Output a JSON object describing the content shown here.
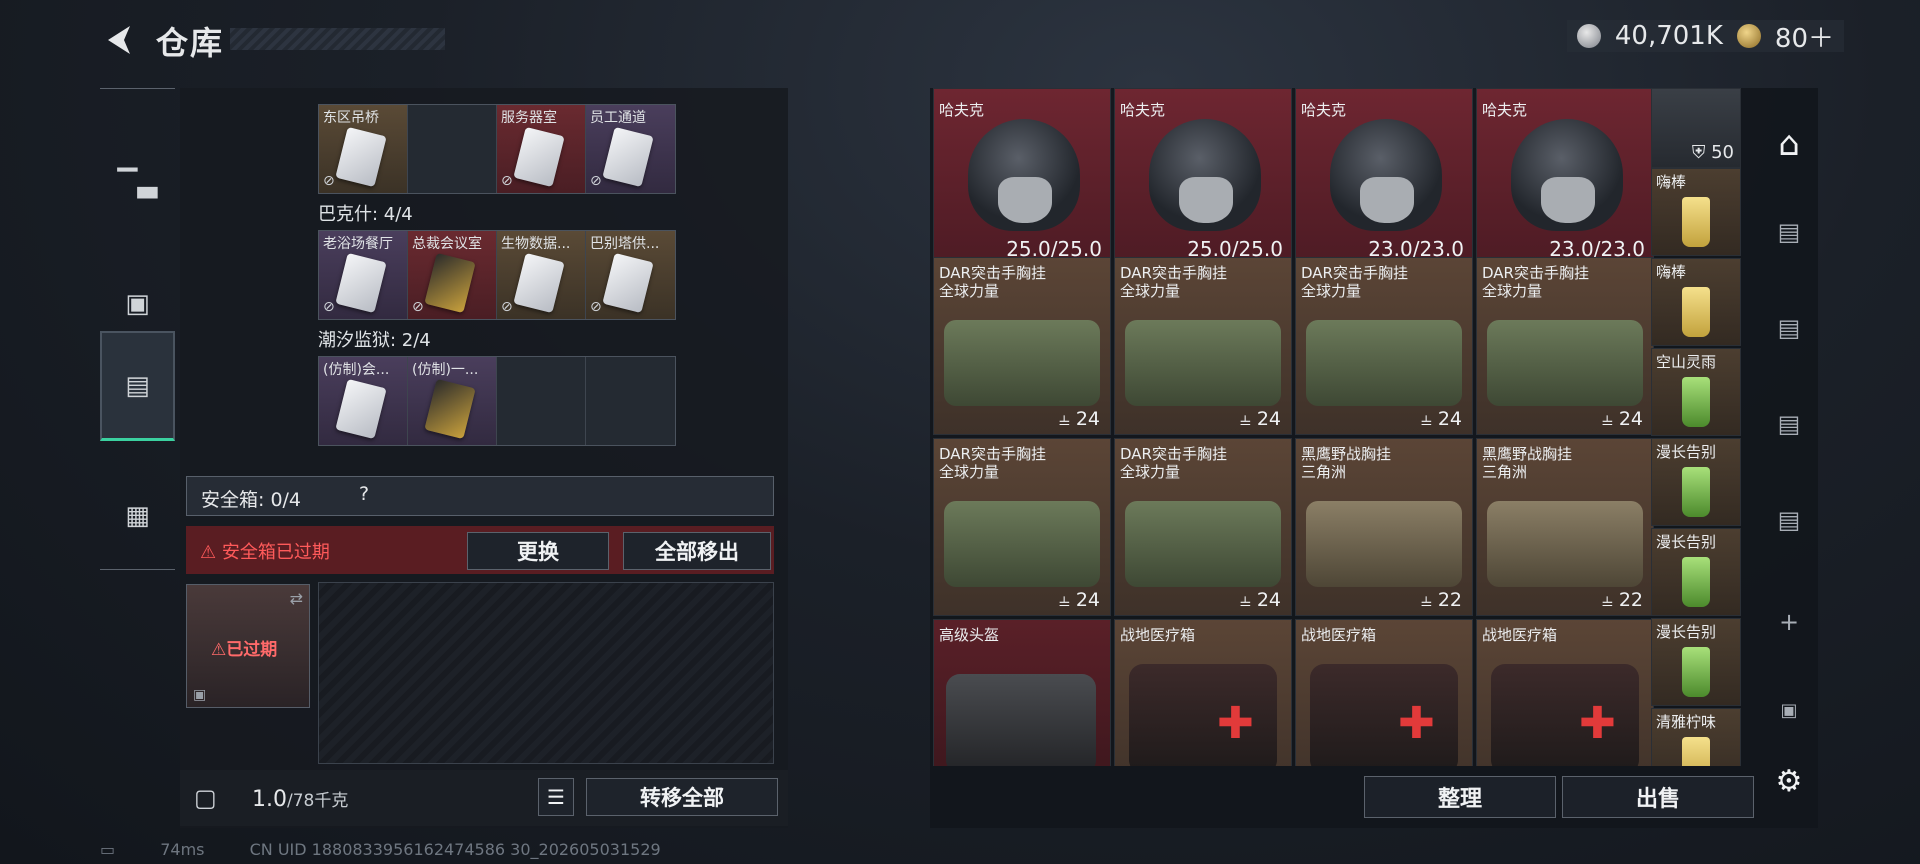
{
  "header": {
    "title": "仓库",
    "silver_amount": "40,701K",
    "gold_amount": "80＋"
  },
  "leftnav": {
    "items": [
      "weapon-icon",
      "key-icon",
      "backpack-icon",
      "toolbox-icon"
    ]
  },
  "keys": {
    "row1_labels": [
      "东区吊桥",
      "",
      "服务器室",
      "员工通道"
    ],
    "group2_label": "巴克什: 4/4",
    "row2_labels": [
      "老浴场餐厅",
      "总裁会议室",
      "生物数据...",
      "巴别塔供..."
    ],
    "group3_label": "潮汐监狱: 2/4",
    "row3_labels": [
      "(仿制)会...",
      "(仿制)一...",
      "",
      ""
    ]
  },
  "safebox": {
    "label": "安全箱: 0/4",
    "help": "?",
    "expired_text": "安全箱已过期",
    "replace_btn": "更换",
    "move_all_btn": "全部移出",
    "slot_text": "已过期"
  },
  "weight": {
    "value": "1.0",
    "unit": "/78千克",
    "transfer_all": "转移全部"
  },
  "stash": {
    "row1": [
      {
        "n1": "",
        "n2": "哈夫克",
        "cnt": "25.0/25.0"
      },
      {
        "n1": "",
        "n2": "哈夫克",
        "cnt": "25.0/25.0"
      },
      {
        "n1": "",
        "n2": "哈夫克",
        "cnt": "23.0/23.0"
      },
      {
        "n1": "",
        "n2": "哈夫克",
        "cnt": "23.0/23.0"
      }
    ],
    "row2": [
      {
        "n1": "DAR突击手胸挂",
        "n2": "全球力量",
        "cnt": "24"
      },
      {
        "n1": "DAR突击手胸挂",
        "n2": "全球力量",
        "cnt": "24"
      },
      {
        "n1": "DAR突击手胸挂",
        "n2": "全球力量",
        "cnt": "24"
      },
      {
        "n1": "DAR突击手胸挂",
        "n2": "全球力量",
        "cnt": "24"
      }
    ],
    "row3": [
      {
        "n1": "DAR突击手胸挂",
        "n2": "全球力量",
        "cnt": "24"
      },
      {
        "n1": "DAR突击手胸挂",
        "n2": "全球力量",
        "cnt": "24"
      },
      {
        "n1": "黑鹰野战胸挂",
        "n2": "三角洲",
        "cnt": "22"
      },
      {
        "n1": "黑鹰野战胸挂",
        "n2": "三角洲",
        "cnt": "22"
      }
    ],
    "row4": [
      {
        "n1": "高级头盔",
        "n2": "",
        "cnt": ""
      },
      {
        "n1": "战地医疗箱",
        "n2": "",
        "cnt": ""
      },
      {
        "n1": "战地医疗箱",
        "n2": "",
        "cnt": ""
      },
      {
        "n1": "战地医疗箱",
        "n2": "",
        "cnt": ""
      }
    ],
    "side": [
      {
        "n": "",
        "badge": "50"
      },
      {
        "n": "嗨棒"
      },
      {
        "n": "嗨棒"
      },
      {
        "n": "空山灵雨"
      },
      {
        "n": "漫长告别"
      },
      {
        "n": "漫长告别"
      },
      {
        "n": "漫长告别"
      },
      {
        "n": "清雅柠味"
      }
    ]
  },
  "actions": {
    "sort": "整理",
    "sell": "出售"
  },
  "footer": {
    "ping": "74ms",
    "uid": "CN UID 1880833956162474586 30_202605031529"
  }
}
